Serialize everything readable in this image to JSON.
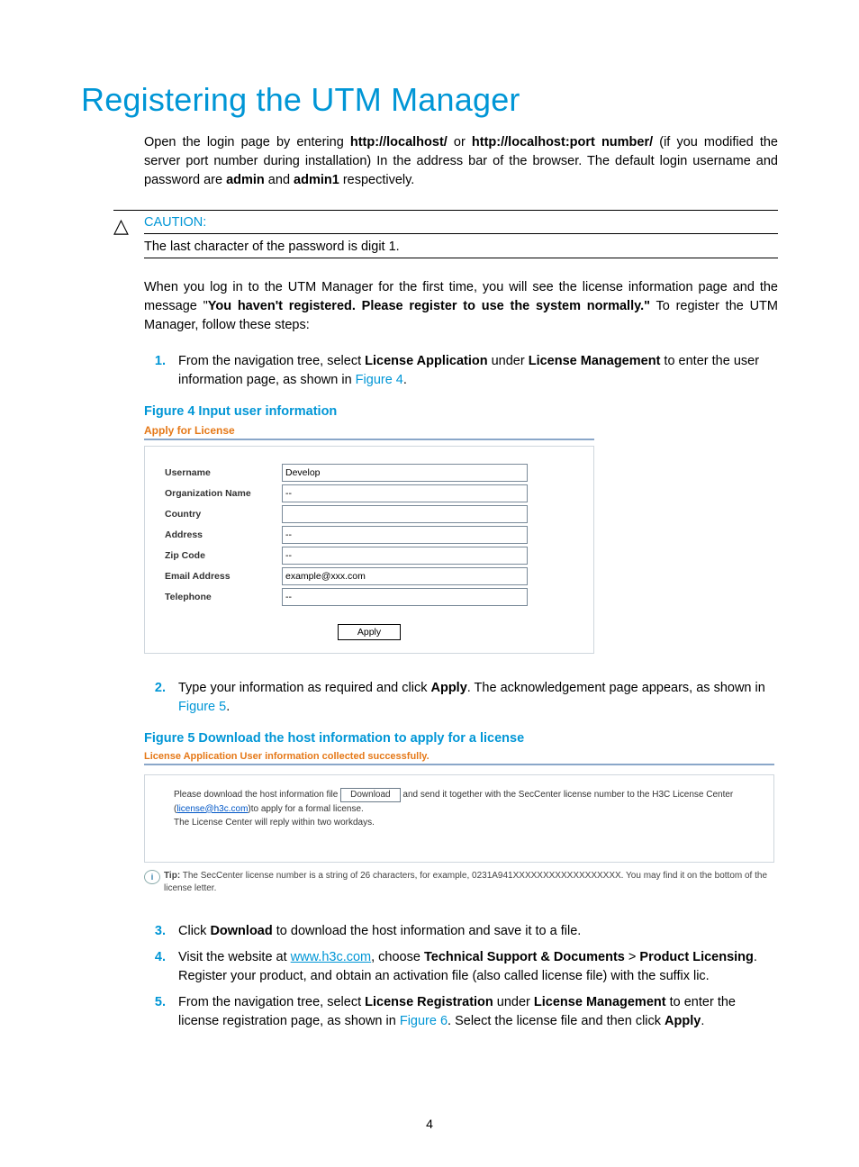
{
  "pageNumber": "4",
  "title": "Registering the UTM Manager",
  "p1_a": "Open the login page by entering ",
  "p1_b1": "http://localhost/",
  "p1_mid": " or ",
  "p1_b2": "http://localhost:port number/",
  "p1_c": " (if you modified the server port number during installation) In the address bar of the browser. The default login username and password are ",
  "p1_b3": "admin",
  "p1_and": " and ",
  "p1_b4": "admin1",
  "p1_end": " respectively.",
  "caution_label": "CAUTION:",
  "caution_text": "The last character of the password is digit 1.",
  "p2_a": "When you log in to the UTM Manager for the first time, you will see the license information page and the message \"",
  "p2_b": "You haven't registered. Please register to use the system normally.\"",
  "p2_c": " To register the UTM Manager, follow these steps:",
  "step1_a": "From the navigation tree, select ",
  "step1_b1": "License Application",
  "step1_mid": " under ",
  "step1_b2": "License Management",
  "step1_c": " to enter the user information page, as shown in ",
  "step1_link": "Figure 4",
  "step1_end": ".",
  "fig4_caption": "Figure 4 Input user information",
  "fig4": {
    "panelTitle": "Apply for License",
    "labels": {
      "username": "Username",
      "org": "Organization Name",
      "country": "Country",
      "address": "Address",
      "zip": "Zip Code",
      "email": "Email Address",
      "tel": "Telephone"
    },
    "values": {
      "username": "Develop",
      "org": "--",
      "country": "",
      "address": "--",
      "zip": "--",
      "email": "example@xxx.com",
      "tel": "--"
    },
    "applyLabel": "Apply"
  },
  "step2_a": "Type your information as required and click ",
  "step2_b": "Apply",
  "step2_c": ". The acknowledgement page appears, as shown in ",
  "step2_link": "Figure 5",
  "step2_end": ".",
  "fig5_caption": "Figure 5 Download the host information to apply for a license",
  "fig5": {
    "panelTitle": "License Application User information collected successfully.",
    "line1_a": "Please download the host information file ",
    "downloadLabel": "Download",
    "line1_b": " and send it together with the SecCenter license number to the H3C License Center (",
    "email": "license@h3c.com",
    "line1_c": ")to apply for a formal license.",
    "line2": "The License Center will reply within two workdays.",
    "tipLabel": "Tip:",
    "tipText": " The SecCenter license number is a string of 26 characters, for example, 0231A941XXXXXXXXXXXXXXXXXX. You may find it on the bottom of the license letter."
  },
  "step3_a": "Click ",
  "step3_b": "Download",
  "step3_c": " to download the host information and save it to a file.",
  "step4_a": "Visit the website at ",
  "step4_link": "www.h3c.com",
  "step4_b": ", choose ",
  "step4_bold1": "Technical Support & Documents",
  "step4_gt": " > ",
  "step4_bold2": "Product Licensing",
  "step4_c": ". Register your product, and obtain an activation file (also called license file) with the suffix lic.",
  "step5_a": "From the navigation tree, select ",
  "step5_b1": "License Registration",
  "step5_mid": " under ",
  "step5_b2": "License Management",
  "step5_c": " to enter the license registration page, as shown in ",
  "step5_link": "Figure 6",
  "step5_d": ". Select the license file and then click ",
  "step5_b3": "Apply",
  "step5_end": "."
}
